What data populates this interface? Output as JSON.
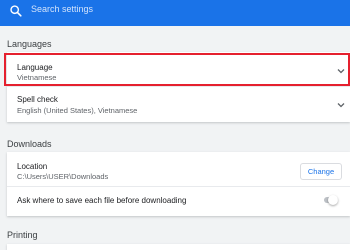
{
  "search": {
    "placeholder": "Search settings"
  },
  "sections": {
    "languages": {
      "title": "Languages",
      "language": {
        "label": "Language",
        "value": "Vietnamese"
      },
      "spell_check": {
        "label": "Spell check",
        "value": "English (United States), Vietnamese"
      }
    },
    "downloads": {
      "title": "Downloads",
      "location": {
        "label": "Location",
        "value": "C:\\Users\\USER\\Downloads",
        "button": "Change"
      },
      "ask_where": {
        "label": "Ask where to save each file before downloading",
        "enabled": false
      }
    },
    "printing": {
      "title": "Printing"
    }
  },
  "colors": {
    "accent": "#1a73e8",
    "highlight": "#e5202e",
    "background": "#f1f3f4"
  }
}
